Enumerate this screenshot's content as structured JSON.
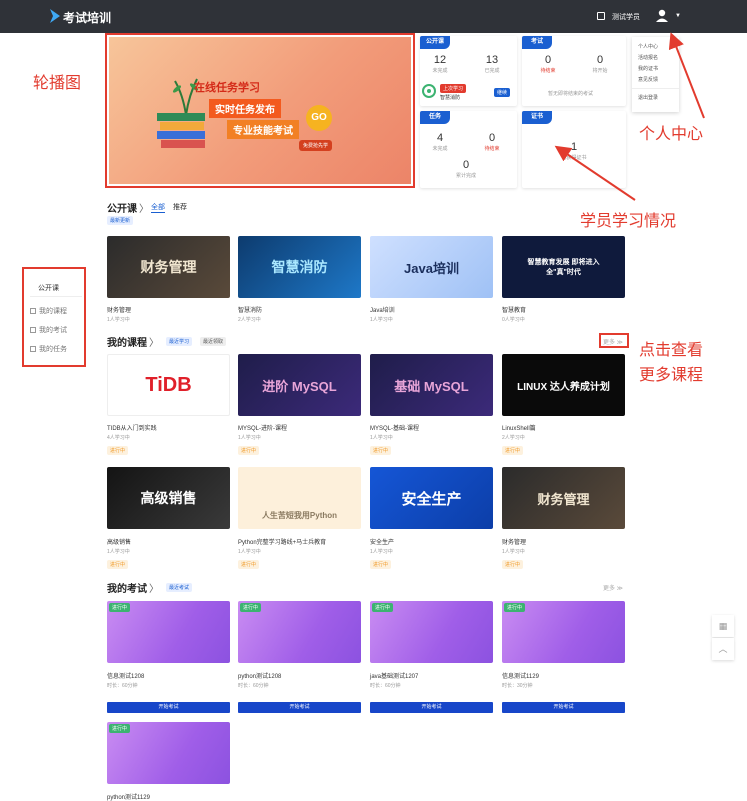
{
  "header": {
    "app_title": "考试培训",
    "user_name": "测试学员"
  },
  "user_menu": [
    "个人中心",
    "活动报名",
    "我的证书",
    "意见反馈",
    "退出登录"
  ],
  "banner": {
    "line1": "在线任务学习",
    "line2": "实时任务发布",
    "line3": "专业技能考试",
    "badge": "GO",
    "cta": "免费抢先学"
  },
  "stats": {
    "public_course": {
      "label": "公开课",
      "unfinished_value": "12",
      "unfinished_label": "未完成",
      "done_value": "13",
      "done_label": "已完成",
      "status_tag": "上次学习",
      "course_name": "智慧消防",
      "continue_label": "继续"
    },
    "exam": {
      "label": "考试",
      "pending_value": "0",
      "pending_label": "待结束",
      "ended_value": "0",
      "ended_label": "将开始",
      "note": "暂无即将结束的考试"
    },
    "task": {
      "label": "任务",
      "unfinished_value": "4",
      "unfinished_label": "未完成",
      "pending_value": "0",
      "pending_label": "待结束",
      "total_value": "0",
      "total_label": "累计完成"
    },
    "cert": {
      "label": "证书",
      "value": "1",
      "caption": "已获得证书"
    }
  },
  "public_courses": {
    "title": "公开课",
    "tabs": [
      "全部",
      "推荐"
    ],
    "chip": "最新更新",
    "items": [
      {
        "thumb": "财务管理",
        "title": "财务管理",
        "meta": "1人学习中"
      },
      {
        "thumb": "智慧消防",
        "title": "智慧消防",
        "meta": "2人学习中"
      },
      {
        "thumb": "Java培训",
        "title": "Java培训",
        "meta": "1人学习中"
      },
      {
        "thumb": "智慧教育发展 即将进入全\"真\"时代",
        "title": "智慧教育",
        "meta": "0人学习中"
      }
    ]
  },
  "my_courses": {
    "title": "我的课程",
    "chips": [
      "最近学习",
      "最近领取"
    ],
    "more": "更多 ≫",
    "items": [
      {
        "thumb": "TiDB",
        "title": "TIDB从入门到实践",
        "meta": "4人学习中",
        "status": "进行中"
      },
      {
        "thumb": "进阶 MySQL",
        "title": "MYSQL-进阶-课程",
        "meta": "1人学习中",
        "status": "进行中"
      },
      {
        "thumb": "基础 MySQL",
        "title": "MYSQL-基础-课程",
        "meta": "1人学习中",
        "status": "进行中"
      },
      {
        "thumb": "LINUX 达人养成计划",
        "title": "LinuxShell篇",
        "meta": "2人学习中",
        "status": "进行中"
      },
      {
        "thumb": "高级销售",
        "title": "高级销售",
        "meta": "1人学习中",
        "status": "进行中"
      },
      {
        "thumb": "人生苦短我用Python",
        "title": "Python完整学习路线+马士兵教育",
        "meta": "1人学习中",
        "status": "进行中"
      },
      {
        "thumb": "安全生产",
        "title": "安全生产",
        "meta": "1人学习中",
        "status": "进行中"
      },
      {
        "thumb": "财务管理",
        "title": "财务管理",
        "meta": "1人学习中",
        "status": "进行中"
      }
    ]
  },
  "my_exams": {
    "title": "我的考试",
    "chip": "最近考试",
    "more": "更多 ≫",
    "button": "开始考试",
    "items": [
      {
        "tag": "进行中",
        "title": "信息测试1208",
        "meta": "时长：60分钟"
      },
      {
        "tag": "进行中",
        "title": "python测试1208",
        "meta": "时长：60分钟"
      },
      {
        "tag": "进行中",
        "title": "java基础测试1207",
        "meta": "时长：60分钟"
      },
      {
        "tag": "进行中",
        "title": "信息测试1129",
        "meta": "时长：30分钟"
      },
      {
        "tag": "进行中",
        "title": "python测试1129"
      }
    ]
  },
  "sidebar": {
    "head": "公开课",
    "items": [
      "我的课程",
      "我的考试",
      "我的任务"
    ]
  },
  "annotations": {
    "carousel": "轮播图",
    "personal": "个人中心",
    "study": "学员学习情况",
    "more_line1": "点击查看",
    "more_line2": "更多课程"
  }
}
